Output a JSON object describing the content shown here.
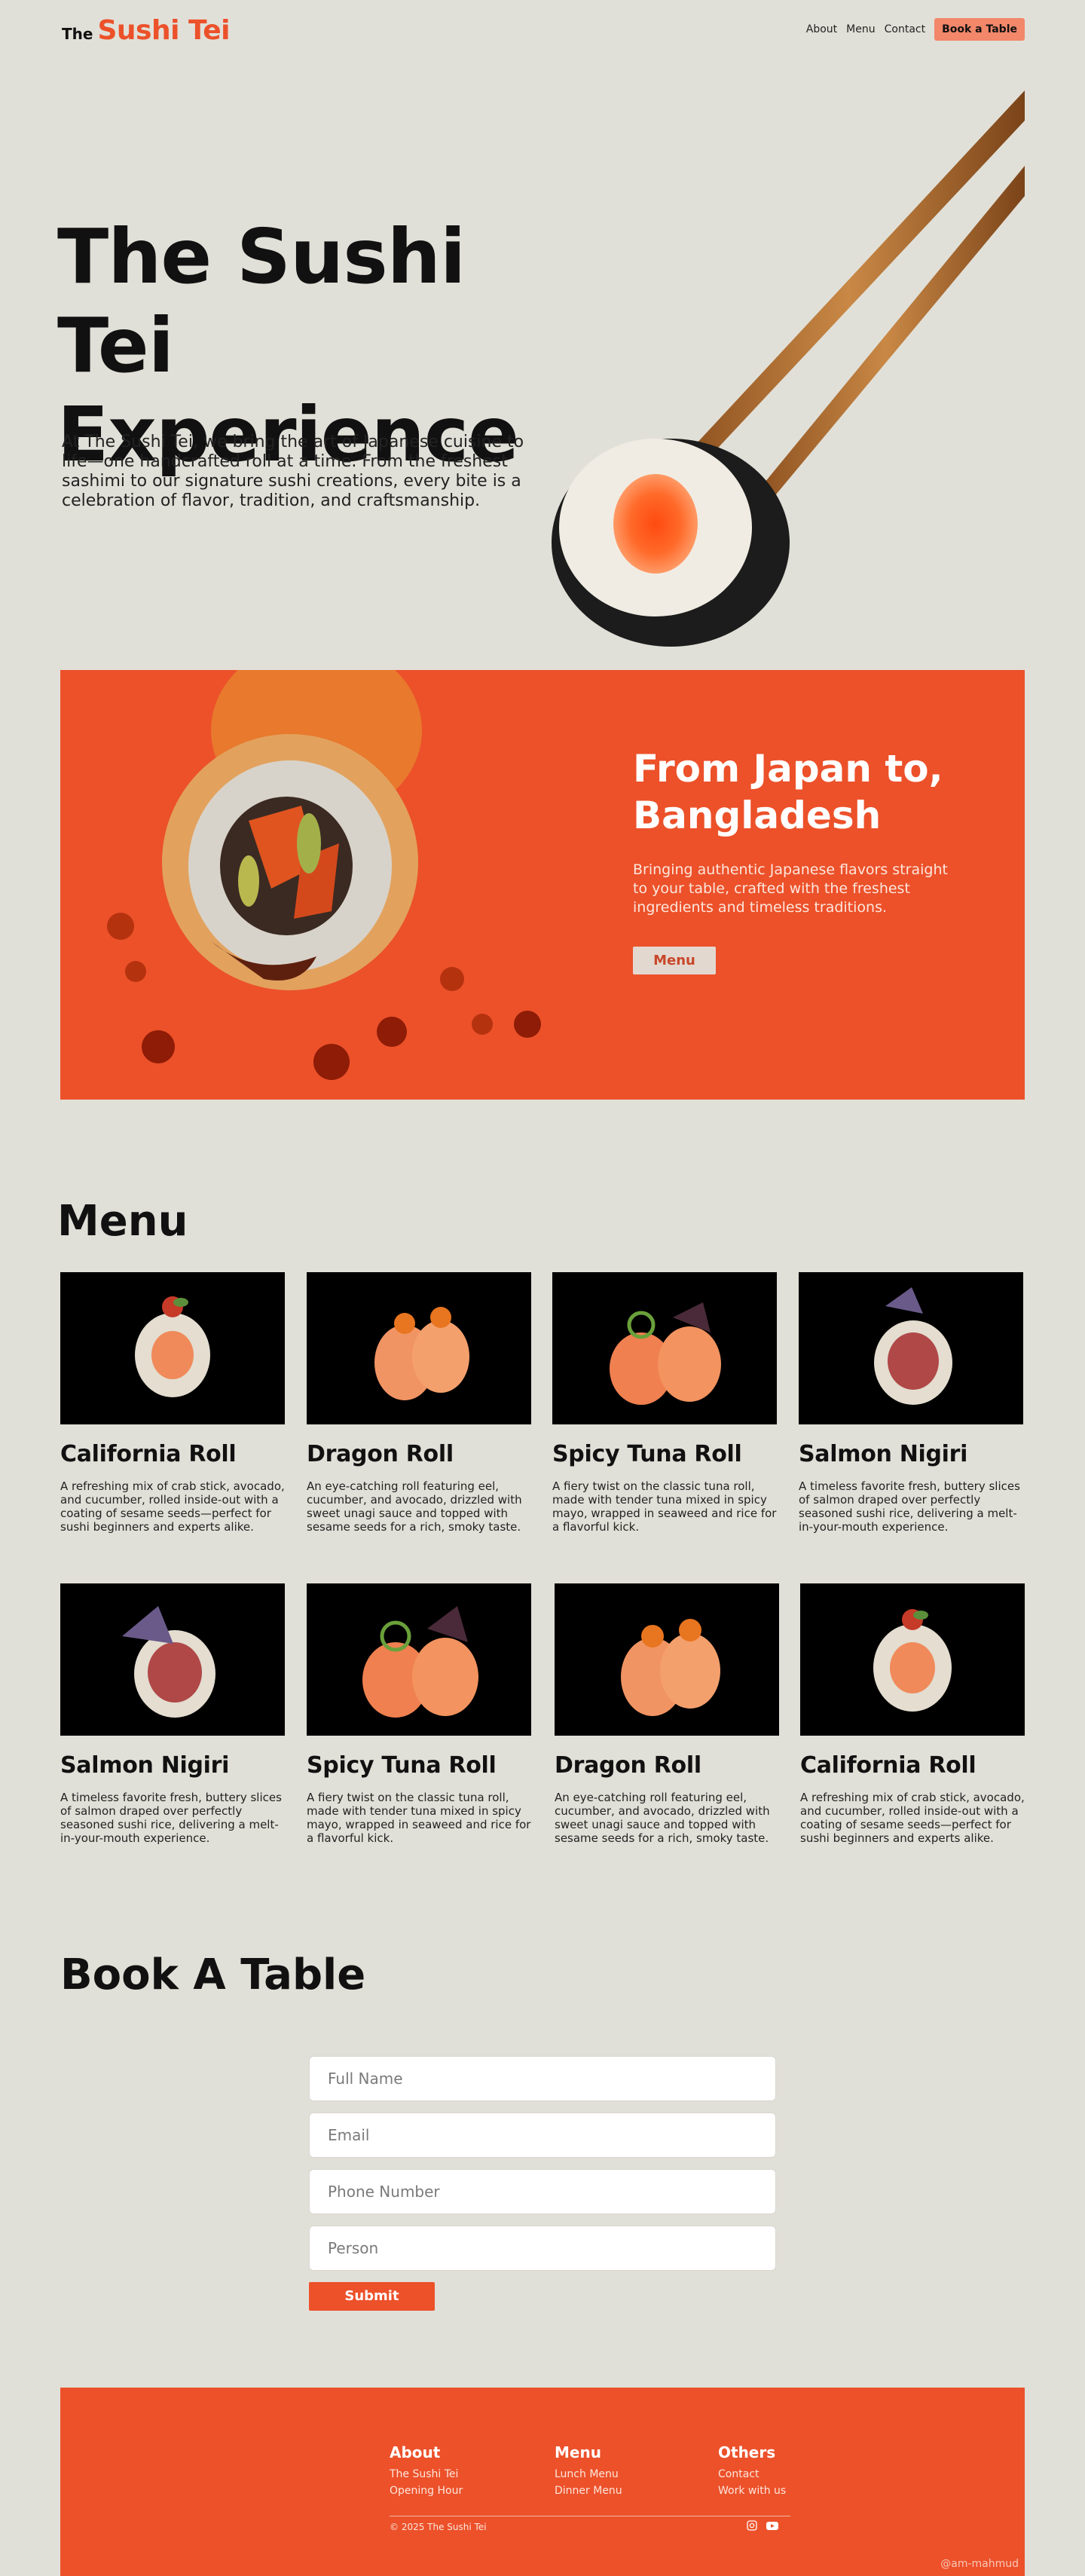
{
  "nav": {
    "logo_the": "The",
    "logo_name": "Sushi Tei",
    "links": [
      "About",
      "Menu",
      "Contact"
    ],
    "cta": "Book a Table"
  },
  "hero": {
    "title": "The Sushi Tei Experience",
    "text": "At The Sushi Tei, we bring the art of Japanese cuisine to life—one handcrafted roll at a time. From the freshest sashimi to our signature sushi creations, every bite is a celebration of flavor, tradition, and craftsmanship."
  },
  "promo": {
    "title": "From Japan to, Bangladesh",
    "text": "Bringing authentic Japanese flavors straight to your table, crafted with the freshest ingredients and timeless traditions.",
    "button": "Menu"
  },
  "menu": {
    "heading": "Menu",
    "items": [
      {
        "name": "California Roll",
        "desc": "A refreshing mix of crab stick, avocado, and cucumber, rolled inside-out with a coating of sesame seeds—perfect for sushi beginners and experts alike."
      },
      {
        "name": "Dragon Roll",
        "desc": "An eye-catching roll featuring eel, cucumber, and avocado, drizzled with sweet unagi sauce and topped with sesame seeds for a rich, smoky taste."
      },
      {
        "name": "Spicy Tuna Roll",
        "desc": "A fiery twist on the classic tuna roll, made with tender tuna mixed in spicy mayo, wrapped in seaweed and rice for a flavorful kick."
      },
      {
        "name": "Salmon Nigiri",
        "desc": "A timeless favorite fresh, buttery slices of salmon draped over perfectly seasoned sushi rice, delivering a melt-in-your-mouth experience."
      },
      {
        "name": "Salmon Nigiri",
        "desc": "A timeless favorite fresh, buttery slices of salmon draped over perfectly seasoned sushi rice, delivering a melt-in-your-mouth experience."
      },
      {
        "name": "Spicy Tuna Roll",
        "desc": "A fiery twist on the classic tuna roll, made with tender tuna mixed in spicy mayo, wrapped in seaweed and rice for a flavorful kick."
      },
      {
        "name": "Dragon Roll",
        "desc": "An eye-catching roll featuring eel, cucumber, and avocado, drizzled with sweet unagi sauce and topped with sesame seeds for a rich, smoky taste."
      },
      {
        "name": "California Roll",
        "desc": "A refreshing mix of crab stick, avocado, and cucumber, rolled inside-out with a coating of sesame seeds—perfect for sushi beginners and experts alike."
      }
    ]
  },
  "booking": {
    "heading": "Book A Table",
    "placeholders": {
      "full_name": "Full Name",
      "email": "Email",
      "phone": "Phone Number",
      "person": "Person"
    },
    "submit": "Submit"
  },
  "footer": {
    "about": {
      "title": "About",
      "links": [
        "The Sushi Tei",
        "Opening Hour"
      ]
    },
    "menu": {
      "title": "Menu",
      "links": [
        "Lunch Menu",
        "Dinner Menu"
      ]
    },
    "others": {
      "title": "Others",
      "links": [
        "Contact",
        "Work with us"
      ]
    },
    "copyright": "© 2025 The Sushi Tei",
    "credit": "@am-mahmud"
  },
  "colors": {
    "accent": "#ec512a",
    "background": "#e1e0d8",
    "button_light": "#f2876a"
  },
  "icons": [
    "instagram-icon",
    "youtube-icon"
  ]
}
